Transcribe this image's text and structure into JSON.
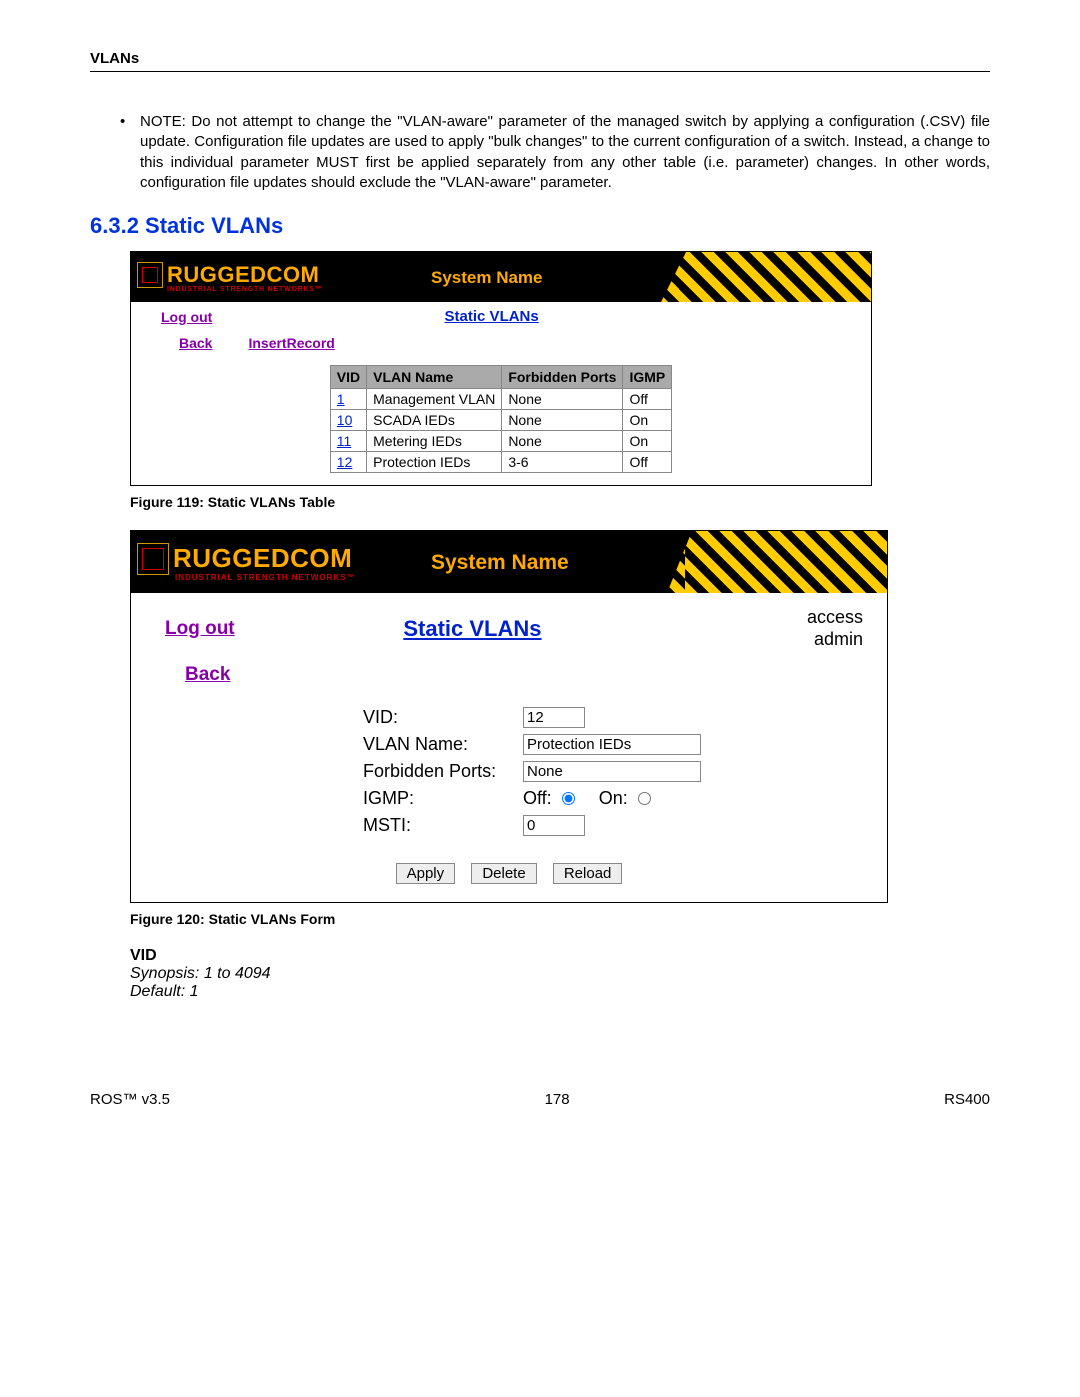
{
  "header": "VLANs",
  "note_text": "NOTE: Do not attempt to change the \"VLAN-aware\" parameter of the managed switch by applying a configuration (.CSV) file update. Configuration file updates are used to apply \"bulk changes\" to the current configuration of a switch. Instead, a change to this individual parameter MUST first be applied separately from any other table (i.e. parameter) changes. In other words, configuration file updates should exclude the \"VLAN-aware\" parameter.",
  "section_heading": "6.3.2  Static VLANs",
  "fig1": {
    "logo_main": "RUGGEDCOM",
    "logo_sub": "INDUSTRIAL STRENGTH NETWORKS™",
    "system_name": "System Name",
    "logout": "Log out",
    "title": "Static VLANs",
    "back": "Back",
    "insert": "InsertRecord",
    "cols": [
      "VID",
      "VLAN Name",
      "Forbidden Ports",
      "IGMP"
    ],
    "rows": [
      {
        "vid": "1",
        "name": "Management VLAN",
        "fp": "None",
        "igmp": "Off"
      },
      {
        "vid": "10",
        "name": "SCADA IEDs",
        "fp": "None",
        "igmp": "On"
      },
      {
        "vid": "11",
        "name": "Metering IEDs",
        "fp": "None",
        "igmp": "On"
      },
      {
        "vid": "12",
        "name": "Protection IEDs",
        "fp": "3-6",
        "igmp": "Off"
      }
    ],
    "caption": "Figure 119: Static VLANs Table"
  },
  "fig2": {
    "logo_main": "RUGGEDCOM",
    "logo_sub": "INDUSTRIAL STRENGTH NETWORKS™",
    "system_name": "System Name",
    "logout": "Log out",
    "title": "Static VLANs",
    "access1": "access",
    "access2": "admin",
    "back": "Back",
    "labels": {
      "vid": "VID:",
      "vlan_name": "VLAN Name:",
      "fp": "Forbidden Ports:",
      "igmp": "IGMP:",
      "msti": "MSTI:"
    },
    "values": {
      "vid": "12",
      "vlan_name": "Protection IEDs",
      "fp": "None",
      "igmp_off": "Off:",
      "igmp_on": "On:",
      "msti": "0"
    },
    "buttons": {
      "apply": "Apply",
      "delete": "Delete",
      "reload": "Reload"
    },
    "caption": "Figure 120: Static VLANs Form"
  },
  "param": {
    "name": "VID",
    "synopsis": "Synopsis: 1 to 4094",
    "default": "Default: 1"
  },
  "footer": {
    "left": "ROS™  v3.5",
    "center": "178",
    "right": "RS400"
  }
}
